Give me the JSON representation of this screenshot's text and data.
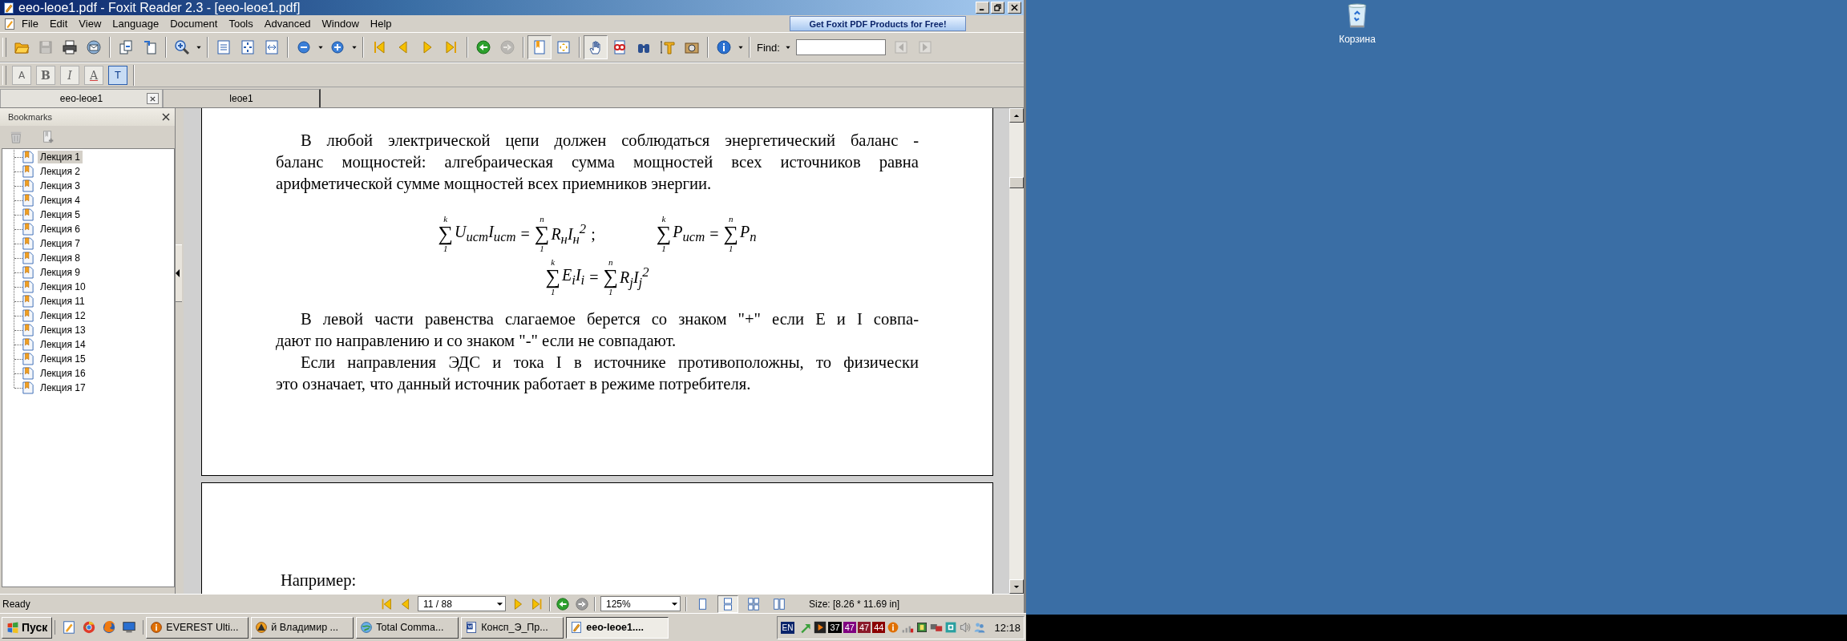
{
  "window": {
    "title": "eeo-leoe1.pdf - Foxit Reader 2.3 - [eeo-leoe1.pdf]"
  },
  "menu": [
    "File",
    "Edit",
    "View",
    "Language",
    "Document",
    "Tools",
    "Advanced",
    "Window",
    "Help"
  ],
  "promo": "Get Foxit PDF Products for Free!",
  "toolbar": [
    [
      {
        "kind": "open",
        "selected": false,
        "disabled": false
      },
      {
        "kind": "save",
        "selected": false,
        "disabled": true
      },
      {
        "kind": "print",
        "selected": false,
        "disabled": false
      },
      {
        "kind": "email",
        "selected": false,
        "disabled": false
      }
    ],
    [
      {
        "kind": "page-copy",
        "selected": false,
        "disabled": false
      },
      {
        "kind": "page-extract",
        "selected": false,
        "disabled": false
      }
    ],
    [
      {
        "kind": "zoom-tool",
        "selected": false,
        "disabled": false
      },
      {
        "kind": "caret",
        "selected": false,
        "disabled": false
      }
    ],
    [
      {
        "kind": "actual-size",
        "selected": false,
        "disabled": false
      },
      {
        "kind": "fit-page",
        "selected": false,
        "disabled": false
      },
      {
        "kind": "fit-width",
        "selected": false,
        "disabled": false
      }
    ],
    [
      {
        "kind": "zoom-out",
        "selected": false,
        "disabled": false
      },
      {
        "kind": "caret",
        "selected": false,
        "disabled": false
      },
      {
        "kind": "zoom-in",
        "selected": false,
        "disabled": false
      },
      {
        "kind": "caret",
        "selected": false,
        "disabled": false
      }
    ],
    [
      {
        "kind": "first",
        "selected": false,
        "disabled": false
      },
      {
        "kind": "prev",
        "selected": false,
        "disabled": false
      },
      {
        "kind": "next",
        "selected": false,
        "disabled": false
      },
      {
        "kind": "last",
        "selected": false,
        "disabled": false
      }
    ],
    [
      {
        "kind": "back",
        "selected": false,
        "disabled": false
      },
      {
        "kind": "forward",
        "selected": false,
        "disabled": true
      }
    ],
    [
      {
        "kind": "bookmark-view",
        "selected": true,
        "disabled": false
      },
      {
        "kind": "fullscreen",
        "selected": false,
        "disabled": false
      }
    ],
    [
      {
        "kind": "hand",
        "selected": true,
        "disabled": false
      },
      {
        "kind": "glasses",
        "selected": false,
        "disabled": false
      },
      {
        "kind": "binoculars",
        "selected": false,
        "disabled": false
      },
      {
        "kind": "text-select",
        "selected": false,
        "disabled": false
      },
      {
        "kind": "snapshot",
        "selected": false,
        "disabled": false
      }
    ],
    [
      {
        "kind": "info",
        "selected": false,
        "disabled": false
      },
      {
        "kind": "caret",
        "selected": false,
        "disabled": false
      }
    ]
  ],
  "find": {
    "label": "Find:",
    "buttons": [
      {
        "kind": "caret",
        "disabled": false
      },
      {
        "kind": "find-prev",
        "disabled": true
      },
      {
        "kind": "find-next",
        "disabled": true
      }
    ]
  },
  "toolbar2": [
    {
      "glyph": "A",
      "kind": "boxed",
      "selected": false
    },
    {
      "glyph": "B",
      "kind": "bold",
      "selected": false
    },
    {
      "glyph": "I",
      "kind": "italic",
      "selected": false
    },
    {
      "glyph": "A",
      "kind": "underline",
      "selected": false
    },
    {
      "glyph": "T",
      "kind": "boxed",
      "selected": true
    }
  ],
  "tabs": [
    {
      "label": "eeo-leoe1",
      "selected": true,
      "closable": true
    },
    {
      "label": "leoe1",
      "selected": false,
      "closable": false
    }
  ],
  "bookmarks": {
    "title": "Bookmarks",
    "items": [
      {
        "label": "Лекция 1",
        "selected": true
      },
      {
        "label": "Лекция 2",
        "selected": false
      },
      {
        "label": "Лекция 3",
        "selected": false
      },
      {
        "label": "Лекция 4",
        "selected": false
      },
      {
        "label": "Лекция 5",
        "selected": false
      },
      {
        "label": "Лекция 6",
        "selected": false
      },
      {
        "label": "Лекция 7",
        "selected": false
      },
      {
        "label": "Лекция 8",
        "selected": false
      },
      {
        "label": "Лекция 9",
        "selected": false
      },
      {
        "label": "Лекция 10",
        "selected": false
      },
      {
        "label": "Лекция 11",
        "selected": false
      },
      {
        "label": "Лекция 12",
        "selected": false
      },
      {
        "label": "Лекция 13",
        "selected": false
      },
      {
        "label": "Лекция 14",
        "selected": false
      },
      {
        "label": "Лекция 15",
        "selected": false
      },
      {
        "label": "Лекция 16",
        "selected": false
      },
      {
        "label": "Лекция 17",
        "selected": false
      }
    ]
  },
  "document": {
    "pages": [
      {
        "blocks": [
          {
            "kind": "paragraph",
            "lines": [
              "В любой электрической цепи должен соблюдаться энергетический  баланс -",
              "баланс мощностей:  алгебраическая сумма мощностей всех источников равна",
              "арифметической сумме мощностей всех приемников энергии."
            ]
          },
          {
            "kind": "formulas",
            "items": [
              [
                {
                  "kind": "sum",
                  "sign": "∑",
                  "upper": "k",
                  "lower": "1"
                },
                {
                  "kind": "var",
                  "text": "U$_{ист}$I$_{ист}$"
                },
                {
                  "kind": "op",
                  "text": "="
                },
                {
                  "kind": "sum",
                  "sign": "∑",
                  "upper": "n",
                  "lower": "1"
                },
                {
                  "kind": "var",
                  "text": "R$_{н}$I$_{н}$$^{2}$"
                },
                {
                  "kind": "op",
                  "text": ";"
                }
              ],
              [
                {
                  "kind": "sum",
                  "sign": "∑",
                  "upper": "k",
                  "lower": "1"
                },
                {
                  "kind": "var",
                  "text": "P$_{ист}$"
                },
                {
                  "kind": "op",
                  "text": "="
                },
                {
                  "kind": "sum",
                  "sign": "∑",
                  "upper": "n",
                  "lower": "1"
                },
                {
                  "kind": "var",
                  "text": "P$_{п}$"
                }
              ]
            ]
          },
          {
            "kind": "formulas",
            "items": [
              [
                {
                  "kind": "sum",
                  "sign": "∑",
                  "upper": "k",
                  "lower": "1"
                },
                {
                  "kind": "var",
                  "text": "E$_{i}$I$_{i}$"
                },
                {
                  "kind": "op",
                  "text": "="
                },
                {
                  "kind": "sum",
                  "sign": "∑",
                  "upper": "n",
                  "lower": "1"
                },
                {
                  "kind": "var",
                  "text": "R$_{j}$I$_{j}$$^{2}$"
                }
              ]
            ]
          },
          {
            "kind": "paragraph",
            "lines": [
              "В левой  части равенства слагаемое берется со знаком \"+\" если Е и I совпа-",
              "дают по направлению и со знаком \"-\" если не совпадают."
            ]
          },
          {
            "kind": "paragraph",
            "lines": [
              "Если направления ЭДС и тока I в источнике противоположны,  то физически",
              "это означает, что данный источник работает в режиме потребителя."
            ]
          }
        ]
      },
      {
        "blocks": [
          {
            "kind": "paragraph",
            "lines": [
              "Например:"
            ]
          }
        ]
      }
    ]
  },
  "status_bar": {
    "message": "Ready",
    "page_field": "11 / 88",
    "zoom_field": "125%",
    "views": [
      {
        "kind": "single",
        "selected": false
      },
      {
        "kind": "continuous",
        "selected": true
      },
      {
        "kind": "facing",
        "selected": false
      },
      {
        "kind": "continuous-facing",
        "selected": false
      }
    ],
    "size": "Size: [8.26 * 11.69 in]"
  },
  "taskbar": {
    "start": "Пуск",
    "tasks": [
      {
        "kind": "info",
        "label": "EVEREST Ulti...",
        "selected": false
      },
      {
        "kind": "triangle",
        "label": "й Владимир ...",
        "selected": false
      },
      {
        "kind": "globe",
        "label": "Total Comma...",
        "selected": false
      },
      {
        "kind": "document",
        "label": "Консп_Э_Пр...",
        "selected": false
      },
      {
        "kind": "pdf",
        "label": "eeo-leoe1....",
        "selected": true
      }
    ],
    "tray": {
      "language": "EN",
      "badges": [
        {
          "text": "37",
          "color": "#000000"
        },
        {
          "text": "47",
          "color": "#800080"
        },
        {
          "text": "47",
          "color": "#8b1a2a"
        },
        {
          "text": "44",
          "color": "#8b0000"
        }
      ],
      "clock": "12:18"
    }
  },
  "desktop_icons": [
    {
      "label": "Корзина"
    }
  ]
}
